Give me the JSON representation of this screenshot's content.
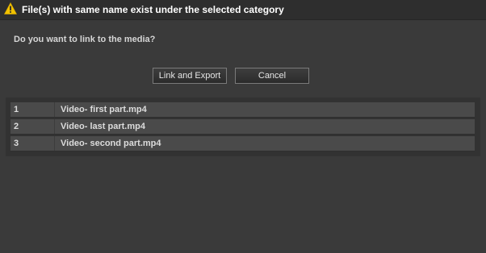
{
  "dialog": {
    "title": "File(s) with same name exist under  the selected category",
    "title_icon": "warning-icon",
    "question": "Do you want to link to the media?",
    "buttons": {
      "link_export": "Link and Export",
      "cancel": "Cancel"
    },
    "files": [
      {
        "index": "1",
        "name": "Video- first part.mp4"
      },
      {
        "index": "2",
        "name": "Video- last part.mp4"
      },
      {
        "index": "3",
        "name": "Video- second part.mp4"
      }
    ]
  },
  "colors": {
    "background": "#3a3a3a",
    "titlebar": "#2e2e2e",
    "row": "#4a4a4a",
    "warning": "#f2c200"
  }
}
